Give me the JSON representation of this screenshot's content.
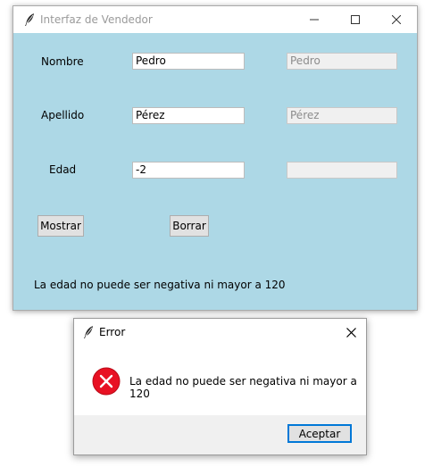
{
  "main_window": {
    "title": "Interfaz de Vendedor",
    "icon": "feather-icon",
    "controls": {
      "minimize": "minimize-icon",
      "maximize": "maximize-icon",
      "close": "close-icon"
    },
    "form": {
      "nombre": {
        "label": "Nombre",
        "value": "Pedro",
        "display": "Pedro"
      },
      "apellido": {
        "label": "Apellido",
        "value": "Pérez",
        "display": "Pérez"
      },
      "edad": {
        "label": "Edad",
        "value": "-2",
        "display": ""
      }
    },
    "buttons": {
      "show": "Mostrar",
      "clear": "Borrar"
    },
    "status_message": "La edad no puede ser negativa ni mayor a 120",
    "background_color": "#add8e6"
  },
  "error_dialog": {
    "title": "Error",
    "icon": "feather-icon",
    "status_icon": "error-icon",
    "message": "La edad no puede ser negativa ni mayor a 120",
    "ok_label": "Aceptar",
    "accent_color": "#0078d7",
    "error_color": "#e81123"
  }
}
